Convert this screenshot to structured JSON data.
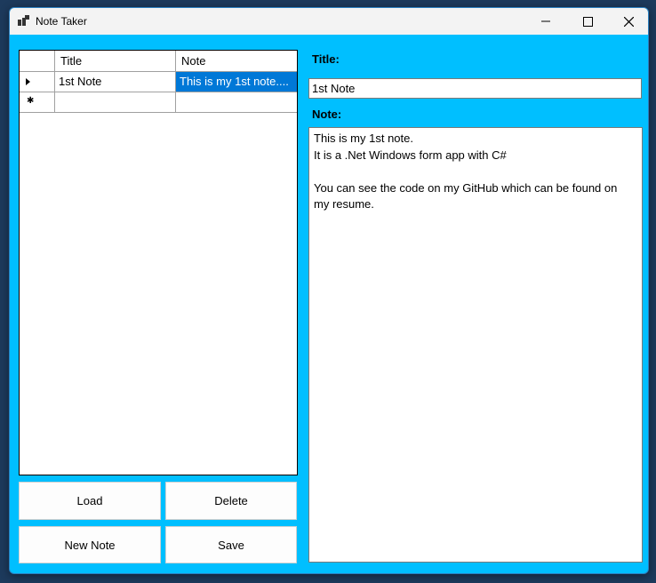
{
  "window": {
    "title": "Note Taker"
  },
  "grid": {
    "columns": [
      "Title",
      "Note"
    ],
    "rows": [
      {
        "title": "1st Note",
        "note": "This is my 1st note...."
      }
    ]
  },
  "buttons": {
    "load": "Load",
    "delete": "Delete",
    "new_note": "New Note",
    "save": "Save"
  },
  "editor": {
    "title_label": "Title:",
    "title_value": "1st Note",
    "note_label": "Note:",
    "note_lines": [
      "This is my 1st note.",
      "It is a .Net Windows form app with C#",
      "",
      "You can see the code on my GitHub which can be found on",
      "my resume."
    ]
  },
  "colors": {
    "form_background": "#00bfff",
    "selection": "#0078d7"
  }
}
